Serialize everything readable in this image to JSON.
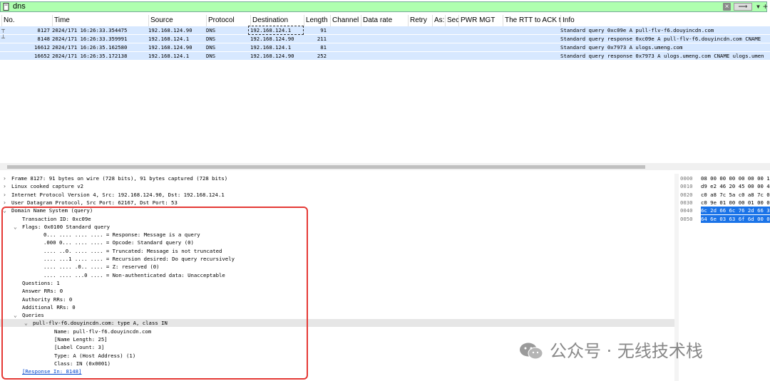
{
  "filter": {
    "value": "dns",
    "icon": "bookmark-icon",
    "plus": "+"
  },
  "columns": [
    "No.",
    "Time",
    "Source",
    "Protocol",
    "Destination",
    "Length",
    "Channel",
    "Data rate",
    "Retry",
    "As:",
    "Sec",
    "PWR MGT",
    "The RTT to ACK th",
    "Info"
  ],
  "packets": [
    {
      "no": "8127",
      "time": "2024/171 16:26:33.354475",
      "src": "192.168.124.90",
      "proto": "DNS",
      "dst": "192.168.124.1",
      "len": "91",
      "info": "Standard query 0xc09e A pull-flv-f6.douyincdn.com"
    },
    {
      "no": "8148",
      "time": "2024/171 16:26:33.359991",
      "src": "192.168.124.1",
      "proto": "DNS",
      "dst": "192.168.124.90",
      "len": "211",
      "info": "Standard query response 0xc09e A pull-flv-f6.douyincdn.com CNAME"
    },
    {
      "no": "16612",
      "time": "2024/171 16:26:35.162580",
      "src": "192.168.124.90",
      "proto": "DNS",
      "dst": "192.168.124.1",
      "len": "81",
      "info": "Standard query 0x7973 A ulogs.umeng.com"
    },
    {
      "no": "16652",
      "time": "2024/171 16:26:35.172138",
      "src": "192.168.124.1",
      "proto": "DNS",
      "dst": "192.168.124.90",
      "len": "252",
      "info": "Standard query response 0x7973 A ulogs.umeng.com CNAME ulogs.umen"
    }
  ],
  "details": [
    {
      "tw": ">",
      "indent": 0,
      "text": "Frame 8127: 91 bytes on wire (728 bits), 91 bytes captured (728 bits)"
    },
    {
      "tw": ">",
      "indent": 0,
      "text": "Linux cooked capture v2"
    },
    {
      "tw": ">",
      "indent": 0,
      "text": "Internet Protocol Version 4, Src: 192.168.124.90, Dst: 192.168.124.1"
    },
    {
      "tw": ">",
      "indent": 0,
      "text": "User Datagram Protocol, Src Port: 62167, Dst Port: 53"
    },
    {
      "tw": "v",
      "indent": 0,
      "text": "Domain Name System (query)"
    },
    {
      "tw": "",
      "indent": 1,
      "text": "Transaction ID: 0xc09e"
    },
    {
      "tw": "v",
      "indent": 1,
      "text": "Flags: 0x0100 Standard query"
    },
    {
      "tw": "",
      "indent": 3,
      "text": "0... .... .... .... = Response: Message is a query"
    },
    {
      "tw": "",
      "indent": 3,
      "text": ".000 0... .... .... = Opcode: Standard query (0)"
    },
    {
      "tw": "",
      "indent": 3,
      "text": ".... ..0. .... .... = Truncated: Message is not truncated"
    },
    {
      "tw": "",
      "indent": 3,
      "text": ".... ...1 .... .... = Recursion desired: Do query recursively"
    },
    {
      "tw": "",
      "indent": 3,
      "text": ".... .... .0.. .... = Z: reserved (0)"
    },
    {
      "tw": "",
      "indent": 3,
      "text": ".... .... ...0 .... = Non-authenticated data: Unacceptable"
    },
    {
      "tw": "",
      "indent": 1,
      "text": "Questions: 1"
    },
    {
      "tw": "",
      "indent": 1,
      "text": "Answer RRs: 0"
    },
    {
      "tw": "",
      "indent": 1,
      "text": "Authority RRs: 0"
    },
    {
      "tw": "",
      "indent": 1,
      "text": "Additional RRs: 0"
    },
    {
      "tw": "v",
      "indent": 1,
      "text": "Queries"
    },
    {
      "tw": "v",
      "indent": 2,
      "text": "pull-flv-f6.douyincdn.com: type A, class IN"
    },
    {
      "tw": "",
      "indent": 4,
      "text": "Name: pull-flv-f6.douyincdn.com"
    },
    {
      "tw": "",
      "indent": 4,
      "text": "[Name Length: 25]"
    },
    {
      "tw": "",
      "indent": 4,
      "text": "[Label Count: 3]"
    },
    {
      "tw": "",
      "indent": 4,
      "text": "Type: A (Host Address) (1)"
    },
    {
      "tw": "",
      "indent": 4,
      "text": "Class: IN (0x0001)"
    },
    {
      "tw": "",
      "indent": 1,
      "text": "[Response In: 8148]"
    }
  ],
  "hex": [
    {
      "off": "0000",
      "bytes": "08 00 00 00 00 00 00 1"
    },
    {
      "off": "0010",
      "bytes": "d9 e2 46 20 45 00 00 4"
    },
    {
      "off": "0020",
      "bytes": "c0 a8 7c 5a c0 a8 7c 0"
    },
    {
      "off": "0030",
      "bytes": "c0 9e 01 00 00 01 00 0"
    },
    {
      "off": "0040",
      "bytes": "6c 2d 66 6c 76 2d 66 3"
    },
    {
      "off": "0050",
      "bytes": "64 6e 03 63 6f 6d 00 0"
    }
  ],
  "watermark": "公众号 · 无线技术栈"
}
